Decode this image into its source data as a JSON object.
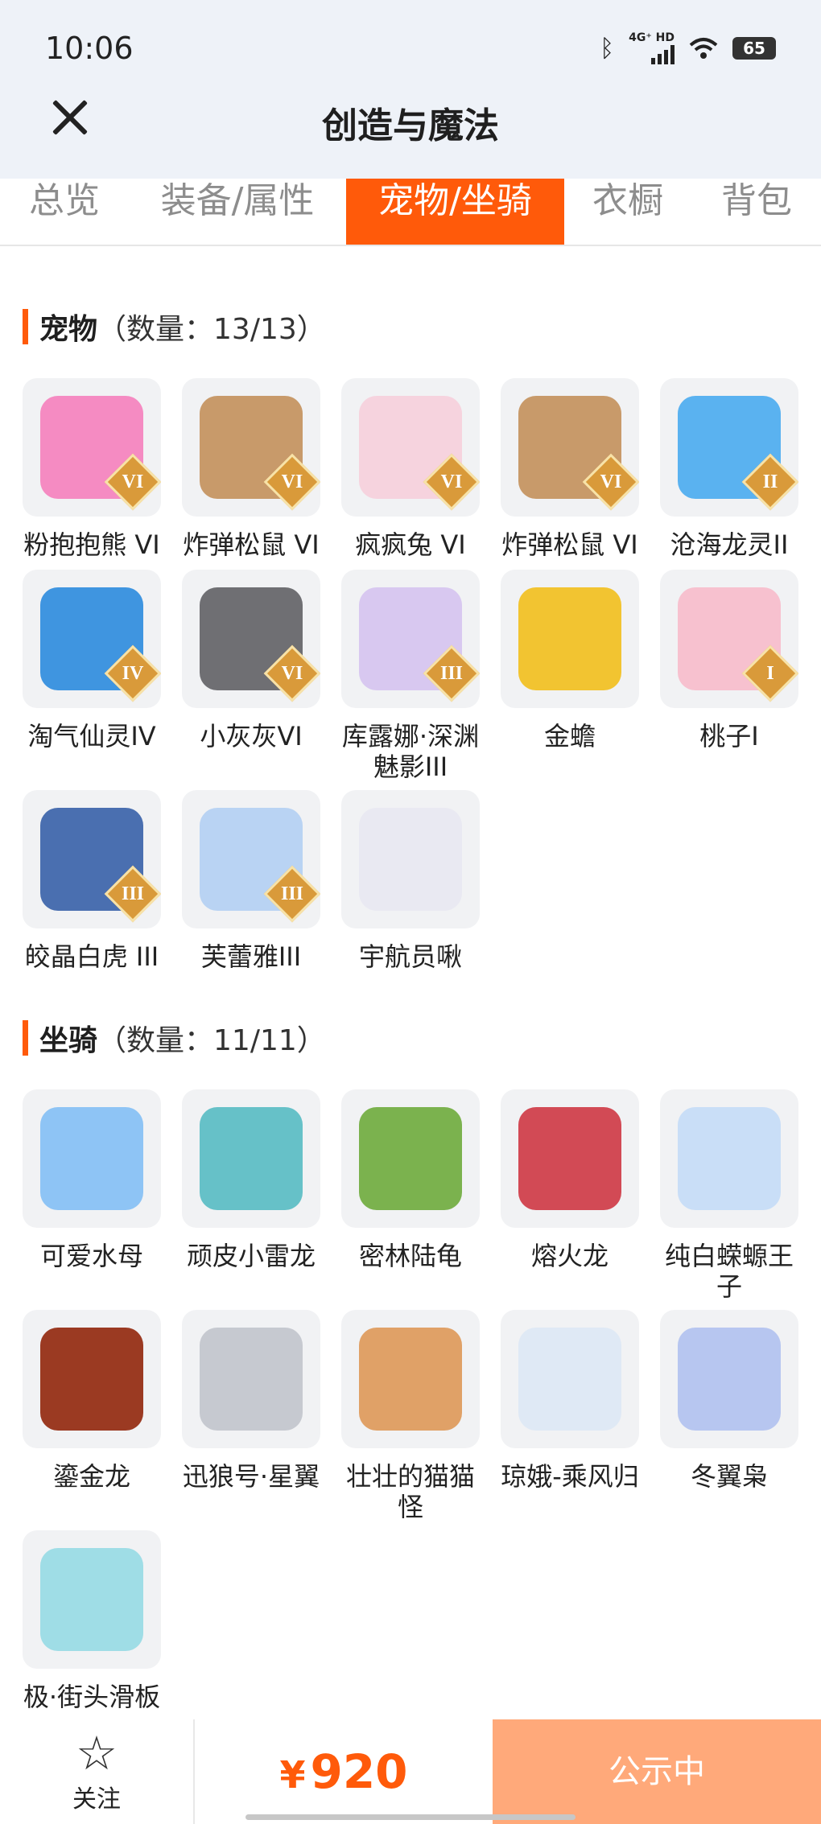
{
  "status_bar": {
    "time": "10:06",
    "network": "4G⁺ HD",
    "battery": "65"
  },
  "header": {
    "title": "创造与魔法"
  },
  "tabs": [
    {
      "label": "总览",
      "active": false
    },
    {
      "label": "装备/属性",
      "active": false
    },
    {
      "label": "宠物/坐骑",
      "active": true
    },
    {
      "label": "衣橱",
      "active": false
    },
    {
      "label": "背包",
      "active": false
    }
  ],
  "pets": {
    "title": "宠物",
    "count": "（数量：13/13）",
    "items": [
      {
        "name": "粉抱抱熊 VI",
        "rank": "VI",
        "icon": "pink-bear-icon",
        "color": "#f58bc2"
      },
      {
        "name": "炸弹松鼠 VI",
        "rank": "VI",
        "icon": "bomb-squirrel-icon",
        "color": "#c89a6a"
      },
      {
        "name": "疯疯兔 VI",
        "rank": "VI",
        "icon": "crazy-rabbit-icon",
        "color": "#f6d3de"
      },
      {
        "name": "炸弹松鼠 VI",
        "rank": "VI",
        "icon": "bomb-squirrel-icon",
        "color": "#c89a6a"
      },
      {
        "name": "沧海龙灵II",
        "rank": "II",
        "icon": "sea-dragon-spirit-icon",
        "color": "#5ab2f0"
      },
      {
        "name": "淘气仙灵IV",
        "rank": "IV",
        "icon": "naughty-fairy-icon",
        "color": "#3f95e0"
      },
      {
        "name": "小灰灰VI",
        "rank": "VI",
        "icon": "grey-wolf-icon",
        "color": "#6f6f73"
      },
      {
        "name": "库露娜·深渊魅影III",
        "rank": "III",
        "icon": "kuluna-abyss-icon",
        "color": "#d8c8f0"
      },
      {
        "name": "金蟾",
        "rank": "",
        "icon": "golden-toad-icon",
        "color": "#f2c431"
      },
      {
        "name": "桃子I",
        "rank": "I",
        "icon": "peach-cat-icon",
        "color": "#f7c1cf"
      },
      {
        "name": "皎晶白虎 III",
        "rank": "III",
        "icon": "white-tiger-icon",
        "color": "#4a6fb0"
      },
      {
        "name": "芙蕾雅III",
        "rank": "III",
        "icon": "freya-icon",
        "color": "#b9d3f3"
      },
      {
        "name": "宇航员啾",
        "rank": "",
        "icon": "astronaut-jiu-icon",
        "color": "#e9e9f2"
      }
    ]
  },
  "mounts": {
    "title": "坐骑",
    "count": "（数量：11/11）",
    "items": [
      {
        "name": "可爱水母",
        "icon": "jellyfish-icon",
        "color": "#8ec4f5"
      },
      {
        "name": "顽皮小雷龙",
        "icon": "thunder-dragon-icon",
        "color": "#66c1c8"
      },
      {
        "name": "密林陆龟",
        "icon": "forest-tortoise-icon",
        "color": "#7bb24e"
      },
      {
        "name": "熔火龙",
        "icon": "lava-dragon-icon",
        "color": "#d24a55"
      },
      {
        "name": "纯白蝾螈王子",
        "icon": "white-axolotl-icon",
        "color": "#c9def7"
      },
      {
        "name": "鎏金龙",
        "icon": "gilded-dragon-icon",
        "color": "#9b3a22"
      },
      {
        "name": "迅狼号·星翼",
        "icon": "mech-wolf-icon",
        "color": "#c6c9d0"
      },
      {
        "name": "壮壮的猫猫怪",
        "icon": "fat-cat-icon",
        "color": "#e0a167"
      },
      {
        "name": "琼娥-乘风归",
        "icon": "moon-fairy-icon",
        "color": "#dfe9f5"
      },
      {
        "name": "冬翼枭",
        "icon": "winter-owl-icon",
        "color": "#b7c6f0"
      },
      {
        "name": "极·街头滑板",
        "icon": "street-skateboard-icon",
        "color": "#9fdde6"
      }
    ]
  },
  "bottom_bar": {
    "follow_label": "关注",
    "currency": "¥",
    "price": "920",
    "status_label": "公示中"
  }
}
